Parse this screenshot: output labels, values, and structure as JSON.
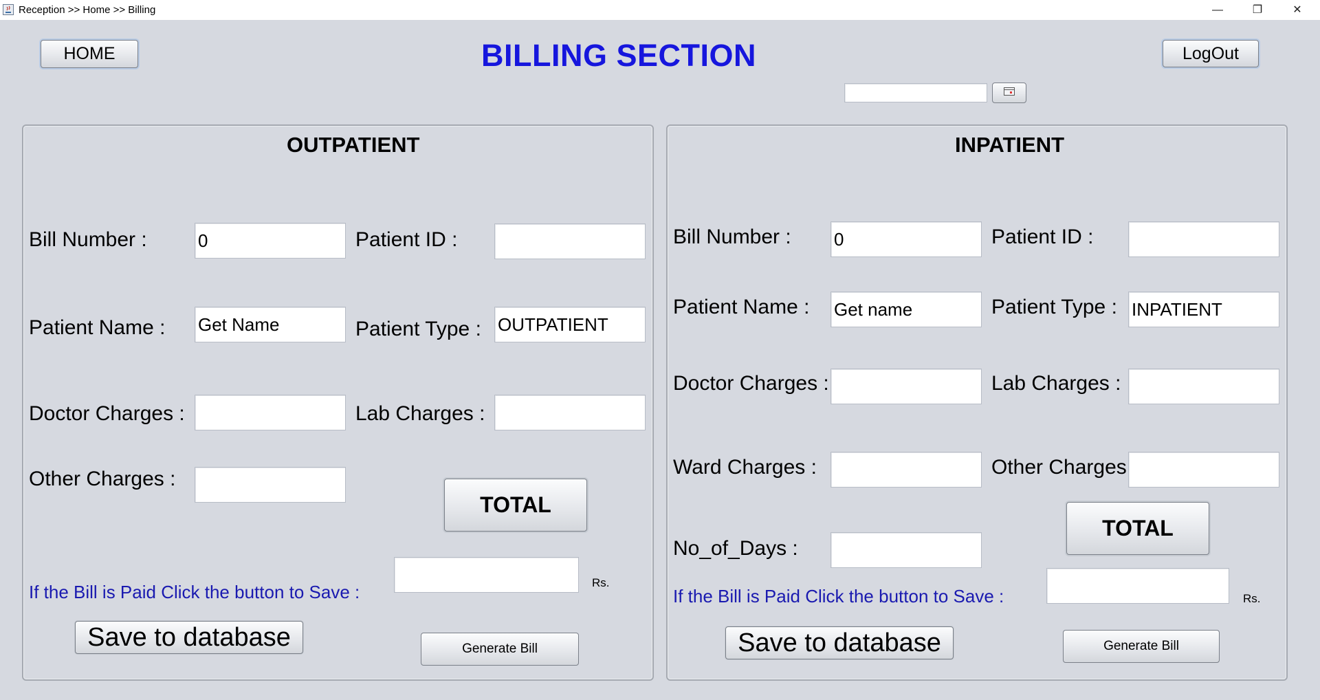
{
  "window": {
    "title": "Reception >> Home >> Billing",
    "minimize_glyph": "—",
    "maximize_glyph": "❐",
    "close_glyph": "✕"
  },
  "header": {
    "home_label": "HOME",
    "title": "BILLING SECTION",
    "logout_label": "LogOut",
    "date_value": ""
  },
  "outpatient": {
    "title": "OUTPATIENT",
    "bill_number_label": "Bill Number :",
    "bill_number_value": "0",
    "patient_id_label": "Patient ID :",
    "patient_id_value": "",
    "patient_name_label": "Patient Name :",
    "patient_name_value": "Get Name",
    "patient_type_label": "Patient Type :",
    "patient_type_value": "OUTPATIENT",
    "doctor_charges_label": "Doctor Charges :",
    "doctor_charges_value": "",
    "lab_charges_label": "Lab Charges :",
    "lab_charges_value": "",
    "other_charges_label": "Other Charges :",
    "other_charges_value": "",
    "total_label": "TOTAL",
    "total_value": "",
    "rs_label": "Rs.",
    "paid_message": "If the Bill is Paid Click the button to Save :",
    "save_label": "Save to database",
    "generate_label": "Generate Bill"
  },
  "inpatient": {
    "title": "INPATIENT",
    "bill_number_label": "Bill Number :",
    "bill_number_value": "0",
    "patient_id_label": "Patient ID :",
    "patient_id_value": "",
    "patient_name_label": "Patient Name :",
    "patient_name_value": "Get name",
    "patient_type_label": "Patient Type :",
    "patient_type_value": "INPATIENT",
    "doctor_charges_label": "Doctor Charges :",
    "doctor_charges_value": "",
    "lab_charges_label": "Lab Charges :",
    "lab_charges_value": "",
    "ward_charges_label": "Ward Charges :",
    "ward_charges_value": "",
    "other_charges_label": "Other Charges",
    "other_charges_value": "",
    "no_of_days_label": "No_of_Days :",
    "no_of_days_value": "",
    "total_label": "TOTAL",
    "total_value": "",
    "rs_label": "Rs.",
    "paid_message": "If the Bill is Paid Click the button to Save :",
    "save_label": "Save to database",
    "generate_label": "Generate Bill"
  }
}
